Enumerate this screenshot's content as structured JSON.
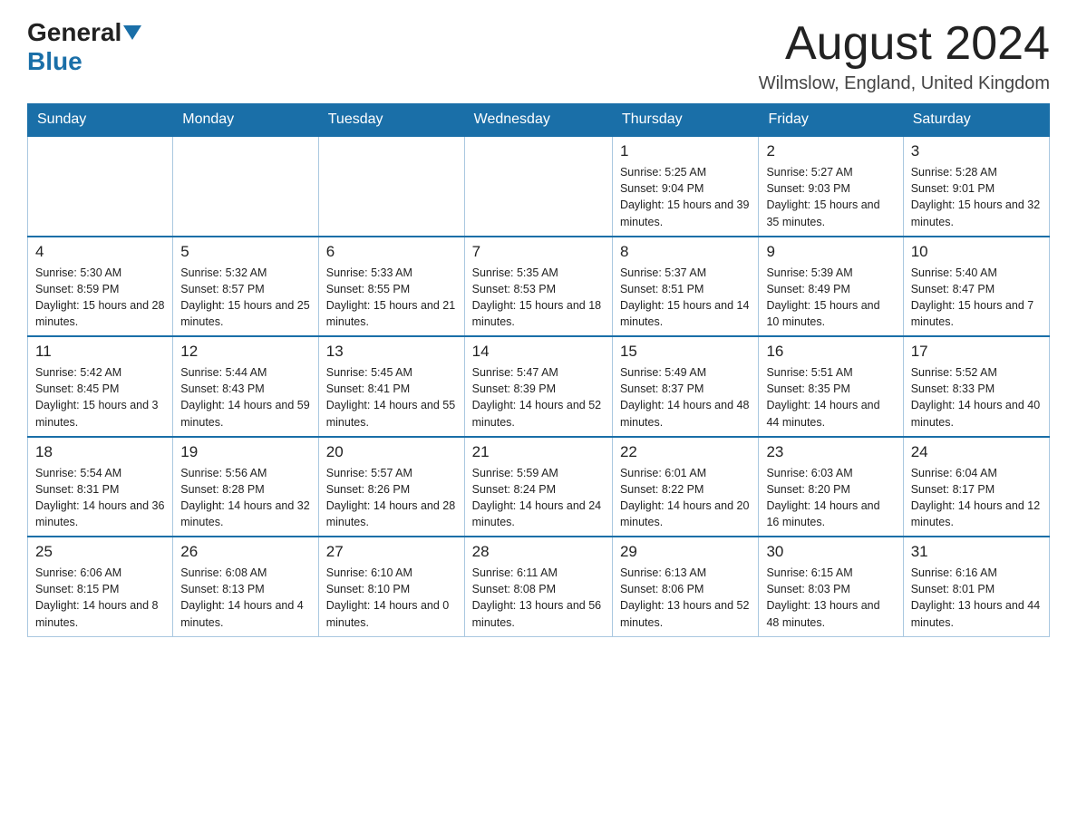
{
  "header": {
    "logo_general": "General",
    "logo_blue": "Blue",
    "month_title": "August 2024",
    "location": "Wilmslow, England, United Kingdom"
  },
  "weekdays": [
    "Sunday",
    "Monday",
    "Tuesday",
    "Wednesday",
    "Thursday",
    "Friday",
    "Saturday"
  ],
  "weeks": [
    [
      {
        "day": "",
        "info": ""
      },
      {
        "day": "",
        "info": ""
      },
      {
        "day": "",
        "info": ""
      },
      {
        "day": "",
        "info": ""
      },
      {
        "day": "1",
        "info": "Sunrise: 5:25 AM\nSunset: 9:04 PM\nDaylight: 15 hours and 39 minutes."
      },
      {
        "day": "2",
        "info": "Sunrise: 5:27 AM\nSunset: 9:03 PM\nDaylight: 15 hours and 35 minutes."
      },
      {
        "day": "3",
        "info": "Sunrise: 5:28 AM\nSunset: 9:01 PM\nDaylight: 15 hours and 32 minutes."
      }
    ],
    [
      {
        "day": "4",
        "info": "Sunrise: 5:30 AM\nSunset: 8:59 PM\nDaylight: 15 hours and 28 minutes."
      },
      {
        "day": "5",
        "info": "Sunrise: 5:32 AM\nSunset: 8:57 PM\nDaylight: 15 hours and 25 minutes."
      },
      {
        "day": "6",
        "info": "Sunrise: 5:33 AM\nSunset: 8:55 PM\nDaylight: 15 hours and 21 minutes."
      },
      {
        "day": "7",
        "info": "Sunrise: 5:35 AM\nSunset: 8:53 PM\nDaylight: 15 hours and 18 minutes."
      },
      {
        "day": "8",
        "info": "Sunrise: 5:37 AM\nSunset: 8:51 PM\nDaylight: 15 hours and 14 minutes."
      },
      {
        "day": "9",
        "info": "Sunrise: 5:39 AM\nSunset: 8:49 PM\nDaylight: 15 hours and 10 minutes."
      },
      {
        "day": "10",
        "info": "Sunrise: 5:40 AM\nSunset: 8:47 PM\nDaylight: 15 hours and 7 minutes."
      }
    ],
    [
      {
        "day": "11",
        "info": "Sunrise: 5:42 AM\nSunset: 8:45 PM\nDaylight: 15 hours and 3 minutes."
      },
      {
        "day": "12",
        "info": "Sunrise: 5:44 AM\nSunset: 8:43 PM\nDaylight: 14 hours and 59 minutes."
      },
      {
        "day": "13",
        "info": "Sunrise: 5:45 AM\nSunset: 8:41 PM\nDaylight: 14 hours and 55 minutes."
      },
      {
        "day": "14",
        "info": "Sunrise: 5:47 AM\nSunset: 8:39 PM\nDaylight: 14 hours and 52 minutes."
      },
      {
        "day": "15",
        "info": "Sunrise: 5:49 AM\nSunset: 8:37 PM\nDaylight: 14 hours and 48 minutes."
      },
      {
        "day": "16",
        "info": "Sunrise: 5:51 AM\nSunset: 8:35 PM\nDaylight: 14 hours and 44 minutes."
      },
      {
        "day": "17",
        "info": "Sunrise: 5:52 AM\nSunset: 8:33 PM\nDaylight: 14 hours and 40 minutes."
      }
    ],
    [
      {
        "day": "18",
        "info": "Sunrise: 5:54 AM\nSunset: 8:31 PM\nDaylight: 14 hours and 36 minutes."
      },
      {
        "day": "19",
        "info": "Sunrise: 5:56 AM\nSunset: 8:28 PM\nDaylight: 14 hours and 32 minutes."
      },
      {
        "day": "20",
        "info": "Sunrise: 5:57 AM\nSunset: 8:26 PM\nDaylight: 14 hours and 28 minutes."
      },
      {
        "day": "21",
        "info": "Sunrise: 5:59 AM\nSunset: 8:24 PM\nDaylight: 14 hours and 24 minutes."
      },
      {
        "day": "22",
        "info": "Sunrise: 6:01 AM\nSunset: 8:22 PM\nDaylight: 14 hours and 20 minutes."
      },
      {
        "day": "23",
        "info": "Sunrise: 6:03 AM\nSunset: 8:20 PM\nDaylight: 14 hours and 16 minutes."
      },
      {
        "day": "24",
        "info": "Sunrise: 6:04 AM\nSunset: 8:17 PM\nDaylight: 14 hours and 12 minutes."
      }
    ],
    [
      {
        "day": "25",
        "info": "Sunrise: 6:06 AM\nSunset: 8:15 PM\nDaylight: 14 hours and 8 minutes."
      },
      {
        "day": "26",
        "info": "Sunrise: 6:08 AM\nSunset: 8:13 PM\nDaylight: 14 hours and 4 minutes."
      },
      {
        "day": "27",
        "info": "Sunrise: 6:10 AM\nSunset: 8:10 PM\nDaylight: 14 hours and 0 minutes."
      },
      {
        "day": "28",
        "info": "Sunrise: 6:11 AM\nSunset: 8:08 PM\nDaylight: 13 hours and 56 minutes."
      },
      {
        "day": "29",
        "info": "Sunrise: 6:13 AM\nSunset: 8:06 PM\nDaylight: 13 hours and 52 minutes."
      },
      {
        "day": "30",
        "info": "Sunrise: 6:15 AM\nSunset: 8:03 PM\nDaylight: 13 hours and 48 minutes."
      },
      {
        "day": "31",
        "info": "Sunrise: 6:16 AM\nSunset: 8:01 PM\nDaylight: 13 hours and 44 minutes."
      }
    ]
  ]
}
